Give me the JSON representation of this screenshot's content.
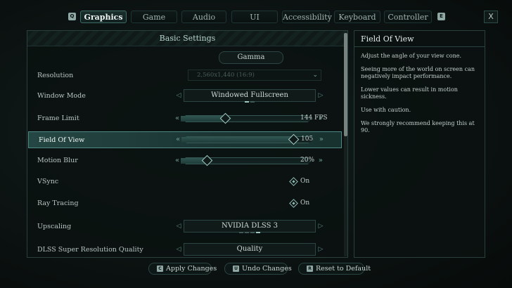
{
  "nav": {
    "prev_key": "Q",
    "next_key": "E",
    "close_label": "X",
    "tabs": [
      {
        "label": "Graphics"
      },
      {
        "label": "Game"
      },
      {
        "label": "Audio"
      },
      {
        "label": "UI"
      },
      {
        "label": "Accessibility"
      },
      {
        "label": "Keyboard"
      },
      {
        "label": "Controller"
      }
    ],
    "active_tab": "Graphics"
  },
  "settings": {
    "header": "Basic Settings",
    "gamma_label": "Gamma",
    "rows": [
      {
        "label": "Resolution",
        "control": "dropdown",
        "value": "2,560x1,440 (16:9)",
        "disabled": true
      },
      {
        "label": "Window Mode",
        "control": "selector",
        "value": "Windowed Fullscreen",
        "option_count": 2,
        "selected_index": 0
      },
      {
        "label": "Frame Limit",
        "control": "slider",
        "value": "144 FPS",
        "level": 0.34
      },
      {
        "label": "Field Of View",
        "control": "slider",
        "value": "105",
        "level": 0.85,
        "highlighted": true
      },
      {
        "label": "Motion Blur",
        "control": "slider",
        "value": "20%",
        "level": 0.2
      },
      {
        "label": "VSync",
        "control": "toggle",
        "value": "On"
      },
      {
        "label": "Ray Tracing",
        "control": "toggle",
        "value": "On"
      },
      {
        "label": "Upscaling",
        "control": "selector",
        "value": "NVIDIA DLSS 3",
        "option_count": 4,
        "selected_index": 3
      },
      {
        "label": "DLSS Super Resolution Quality",
        "control": "selector",
        "value": "Quality"
      }
    ]
  },
  "info": {
    "title": "Field Of View",
    "paragraphs": [
      "Adjust the angle of your view cone.",
      "Seeing more of the world on screen can negatively impact performance.",
      "Lower values can result in motion sickness.",
      "Use with caution.",
      "We strongly recommend keeping this at 90."
    ]
  },
  "actions": {
    "apply": {
      "key": "C",
      "label": "Apply Changes"
    },
    "undo": {
      "key": "U",
      "label": "Undo Changes"
    },
    "reset": {
      "key": "R",
      "label": "Reset to Default"
    }
  },
  "colors": {
    "accent": "#4f8a84",
    "highlight_row": "#1b3533",
    "background": "#0b1211"
  }
}
